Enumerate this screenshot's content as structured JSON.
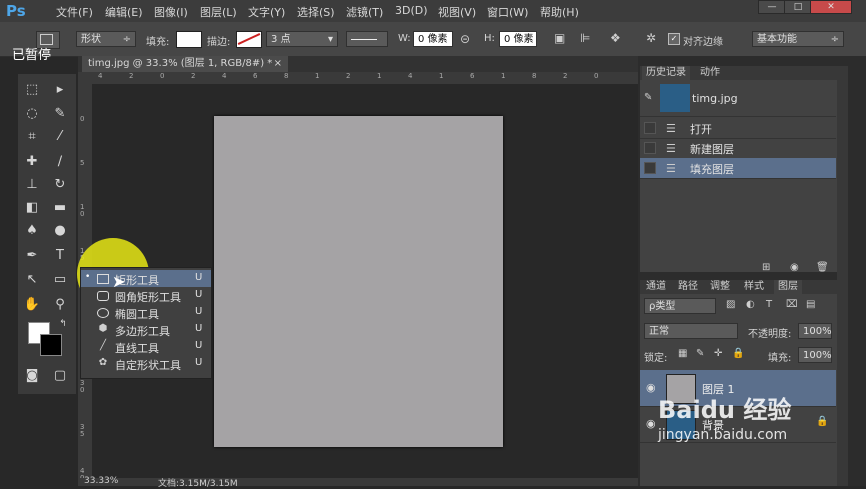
{
  "app": {
    "logo": "Ps"
  },
  "menubar": {
    "items": [
      "文件(F)",
      "编辑(E)",
      "图像(I)",
      "图层(L)",
      "文字(Y)",
      "选择(S)",
      "滤镜(T)",
      "3D(D)",
      "视图(V)",
      "窗口(W)",
      "帮助(H)"
    ],
    "win_min": "—",
    "win_max": "□",
    "win_close": "✕"
  },
  "options": {
    "mode": "形状",
    "fill_label": "填充:",
    "stroke_label": "描边:",
    "stroke_size": "3 点",
    "w_label": "W:",
    "w_value": "0 像素",
    "h_label": "H:",
    "h_value": "0 像素",
    "align_edges": "对齐边缘",
    "workspace": "基本功能"
  },
  "overlay": {
    "paused": "已暂停"
  },
  "document": {
    "tab_title": "timg.jpg @ 33.3% (图层 1, RGB/8#) *",
    "tab_close": "×"
  },
  "ruler": {
    "top": [
      "4",
      "2",
      "0",
      "2",
      "4",
      "6",
      "8",
      "1",
      "2",
      "1",
      "4",
      "1",
      "6",
      "1",
      "8",
      "2",
      "0"
    ],
    "left": [
      "0",
      "5",
      "1 0",
      "1 5",
      "2 0",
      "2 5",
      "3 0",
      "3 5",
      "4 0"
    ]
  },
  "status": {
    "zoom": "33.33%",
    "doc": "文档:3.15M/3.15M"
  },
  "flyout": {
    "items": [
      {
        "label": "矩形工具",
        "key": "U",
        "icon": "rectangle-icon"
      },
      {
        "label": "圆角矩形工具",
        "key": "U",
        "icon": "rounded-rectangle-icon"
      },
      {
        "label": "椭圆工具",
        "key": "U",
        "icon": "ellipse-icon"
      },
      {
        "label": "多边形工具",
        "key": "U",
        "icon": "polygon-icon"
      },
      {
        "label": "直线工具",
        "key": "U",
        "icon": "line-icon"
      },
      {
        "label": "自定形状工具",
        "key": "U",
        "icon": "custom-shape-icon"
      }
    ]
  },
  "history": {
    "tabs": [
      "历史记录",
      "动作"
    ],
    "snapshot": "timg.jpg",
    "items": [
      "打开",
      "新建图层",
      "填充图层"
    ]
  },
  "layers": {
    "tabs": [
      "通道",
      "路径",
      "调整",
      "样式",
      "图层"
    ],
    "filter": "ρ类型",
    "blend": "正常",
    "opacity_label": "不透明度:",
    "opacity": "100%",
    "lock_label": "锁定:",
    "fill_label": "填充:",
    "fill": "100%",
    "items": [
      {
        "name": "图层 1"
      },
      {
        "name": "背景"
      }
    ]
  },
  "watermark": {
    "brand": "Baidu 经验",
    "url": "jingyan.baidu.com"
  },
  "colors": {
    "accent": "#5b6f8c",
    "highlight": "#e6e614",
    "canvas": "#a5a3a5"
  }
}
